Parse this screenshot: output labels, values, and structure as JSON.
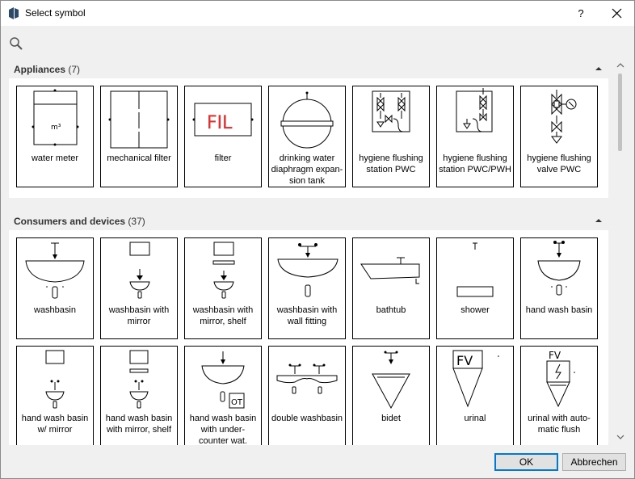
{
  "window": {
    "title": "Select symbol",
    "help_label": "?"
  },
  "search": {
    "placeholder": "",
    "value": ""
  },
  "sections": [
    {
      "name": "Appliances",
      "count": "(7)",
      "items": [
        {
          "label": "water meter",
          "icon": "water-meter-icon"
        },
        {
          "label": "mechanical filter",
          "icon": "mechanical-filter-icon"
        },
        {
          "label": "filter",
          "icon": "filter-icon"
        },
        {
          "label": "drinking water diaphragm expan-sion tank",
          "icon": "expansion-tank-icon"
        },
        {
          "label": "hygiene flushing station PWC",
          "icon": "flushing-station-pwc-icon"
        },
        {
          "label": "hygiene flushing station PWC/PWH",
          "icon": "flushing-station-pwc-pwh-icon"
        },
        {
          "label": "hygiene flushing valve PWC",
          "icon": "flushing-valve-pwc-icon"
        }
      ]
    },
    {
      "name": "Consumers and devices",
      "count": "(37)",
      "items": [
        {
          "label": "washbasin",
          "icon": "washbasin-icon"
        },
        {
          "label": "washbasin with mirror",
          "icon": "washbasin-mirror-icon"
        },
        {
          "label": "washbasin with mirror, shelf",
          "icon": "washbasin-mirror-shelf-icon"
        },
        {
          "label": "washbasin with wall fitting",
          "icon": "washbasin-wall-fitting-icon"
        },
        {
          "label": "bathtub",
          "icon": "bathtub-icon"
        },
        {
          "label": "shower",
          "icon": "shower-icon"
        },
        {
          "label": "hand wash basin",
          "icon": "hand-wash-basin-icon"
        },
        {
          "label": "hand wash basin w/ mirror",
          "icon": "hand-wash-basin-mirror-icon"
        },
        {
          "label": "hand wash basin with mirror, shelf",
          "icon": "hand-wash-basin-mirror-shelf-icon"
        },
        {
          "label": "hand wash basin with under-counter wat.",
          "icon": "hand-wash-basin-undercounter-icon"
        },
        {
          "label": "double washbasin",
          "icon": "double-washbasin-icon"
        },
        {
          "label": "bidet",
          "icon": "bidet-icon"
        },
        {
          "label": "urinal",
          "icon": "urinal-icon"
        },
        {
          "label": "urinal with auto-matic flush",
          "icon": "urinal-auto-flush-icon"
        }
      ]
    }
  ],
  "symbol_text": {
    "filter_fl": "FIL",
    "fv": "FV",
    "ot": "OT",
    "m3": "m³"
  },
  "colors": {
    "filter_red": "#e03030",
    "accent": "#0078d7"
  },
  "buttons": {
    "ok": "OK",
    "cancel": "Abbrechen"
  }
}
